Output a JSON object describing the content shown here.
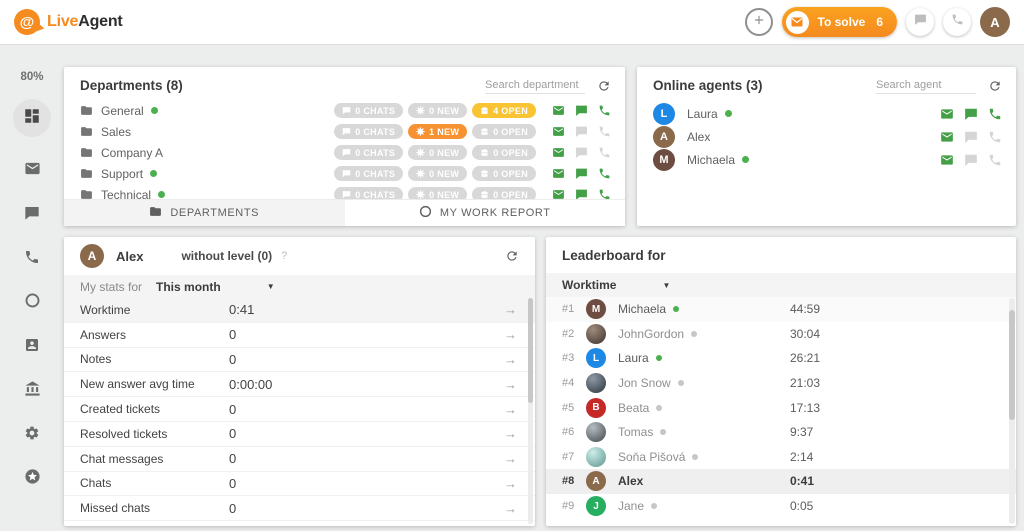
{
  "colors": {
    "brand_orange": "#f68b1f",
    "badge_yellow": "#f8c433",
    "badge_orange": "#f79233",
    "badge_gray": "#d8d8d8",
    "action_green": "#43a047",
    "online_green": "#4caf50",
    "away_gray": "#c6c6c6"
  },
  "header": {
    "logo_at": "@",
    "logo_live": "Live",
    "logo_agent": "Agent",
    "to_solve_label": "To solve",
    "to_solve_count": "6",
    "avatar_initial": "A"
  },
  "sidebar": {
    "usage_percent": "80%",
    "icons": [
      "dashboard",
      "mail",
      "chats",
      "calls",
      "worktime",
      "contacts",
      "company",
      "settings",
      "addons"
    ]
  },
  "departments_panel": {
    "title": "Departments (8)",
    "search_placeholder": "Search department",
    "refresh_icon": "refresh-icon",
    "rows": [
      {
        "name": "General",
        "online": true,
        "badges": [
          {
            "text": "0 CHATS",
            "style": "gray",
            "icon": "chat"
          },
          {
            "text": "0 NEW",
            "style": "gray",
            "icon": "new"
          },
          {
            "text": "4 OPEN",
            "style": "yellow",
            "icon": "open"
          }
        ],
        "mail": "on",
        "chat": "on",
        "phone": "on"
      },
      {
        "name": "Sales",
        "online": false,
        "badges": [
          {
            "text": "0 CHATS",
            "style": "gray",
            "icon": "chat"
          },
          {
            "text": "1 NEW",
            "style": "orange",
            "icon": "new"
          },
          {
            "text": "0 OPEN",
            "style": "gray",
            "icon": "open"
          }
        ],
        "mail": "on",
        "chat": "off",
        "phone": "off"
      },
      {
        "name": "Company A",
        "online": false,
        "badges": [
          {
            "text": "0 CHATS",
            "style": "gray",
            "icon": "chat"
          },
          {
            "text": "0 NEW",
            "style": "gray",
            "icon": "new"
          },
          {
            "text": "0 OPEN",
            "style": "gray",
            "icon": "open"
          }
        ],
        "mail": "on",
        "chat": "off",
        "phone": "off"
      },
      {
        "name": "Support",
        "online": true,
        "badges": [
          {
            "text": "0 CHATS",
            "style": "gray",
            "icon": "chat"
          },
          {
            "text": "0 NEW",
            "style": "gray",
            "icon": "new"
          },
          {
            "text": "0 OPEN",
            "style": "gray",
            "icon": "open"
          }
        ],
        "mail": "on",
        "chat": "on",
        "phone": "on"
      },
      {
        "name": "Technical",
        "online": true,
        "badges": [
          {
            "text": "0 CHATS",
            "style": "gray",
            "icon": "chat"
          },
          {
            "text": "0 NEW",
            "style": "gray",
            "icon": "new"
          },
          {
            "text": "0 OPEN",
            "style": "gray",
            "icon": "open"
          }
        ],
        "mail": "on",
        "chat": "on",
        "phone": "on"
      }
    ],
    "tabs": [
      {
        "label": "DEPARTMENTS",
        "icon": "folder-icon",
        "active": true
      },
      {
        "label": "MY WORK REPORT",
        "icon": "clock-icon",
        "active": false
      }
    ]
  },
  "agents_panel": {
    "title": "Online agents (3)",
    "search_placeholder": "Search agent",
    "rows": [
      {
        "initial": "L",
        "name": "Laura",
        "avatar_color": "#1e88e5",
        "online": true,
        "mail": "on",
        "chat": "on",
        "phone": "on"
      },
      {
        "initial": "A",
        "name": "Alex",
        "avatar_color": "#8a6a4b",
        "online": false,
        "mail": "on",
        "chat": "off",
        "phone": "off"
      },
      {
        "initial": "M",
        "name": "Michaela",
        "avatar_color": "#6d4c41",
        "online": true,
        "mail": "on",
        "chat": "off",
        "phone": "off"
      }
    ]
  },
  "report_panel": {
    "avatar_initial": "A",
    "avatar_color": "#8a6a4b",
    "agent_name": "Alex",
    "level_label": "without level (0)",
    "help": "?",
    "stats_for_label": "My stats for",
    "period": "This month",
    "stats": [
      {
        "label": "Worktime",
        "value": "0:41",
        "highlight": true
      },
      {
        "label": "Answers",
        "value": "0",
        "highlight": false
      },
      {
        "label": "Notes",
        "value": "0",
        "highlight": false
      },
      {
        "label": "New answer avg time",
        "value": "0:00:00",
        "highlight": false
      },
      {
        "label": "Created tickets",
        "value": "0",
        "highlight": false
      },
      {
        "label": "Resolved tickets",
        "value": "0",
        "highlight": false
      },
      {
        "label": "Chat messages",
        "value": "0",
        "highlight": false
      },
      {
        "label": "Chats",
        "value": "0",
        "highlight": false
      },
      {
        "label": "Missed chats",
        "value": "0",
        "highlight": false
      }
    ]
  },
  "leaderboard_panel": {
    "title": "Leaderboard for",
    "metric": "Worktime",
    "rows": [
      {
        "rank": "#1",
        "name": "Michaela",
        "value": "44:59",
        "avatar": {
          "type": "initial",
          "initial": "M",
          "color": "#6d4c41"
        },
        "presence": "online",
        "highlight": "light"
      },
      {
        "rank": "#2",
        "name": "JohnGordon",
        "value": "30:04",
        "avatar": {
          "type": "photo",
          "c1": "#a08c7d",
          "c2": "#3a302a"
        },
        "presence": "away",
        "highlight": "none"
      },
      {
        "rank": "#3",
        "name": "Laura",
        "value": "26:21",
        "avatar": {
          "type": "initial",
          "initial": "L",
          "color": "#1e88e5"
        },
        "presence": "online",
        "highlight": "none"
      },
      {
        "rank": "#4",
        "name": "Jon Snow",
        "value": "21:03",
        "avatar": {
          "type": "photo",
          "c1": "#8d9aa5",
          "c2": "#2b333a"
        },
        "presence": "away",
        "highlight": "none"
      },
      {
        "rank": "#5",
        "name": "Beata",
        "value": "17:13",
        "avatar": {
          "type": "initial",
          "initial": "B",
          "color": "#c62828"
        },
        "presence": "away",
        "highlight": "none"
      },
      {
        "rank": "#6",
        "name": "Tomas",
        "value": "9:37",
        "avatar": {
          "type": "photo",
          "c1": "#b6bec2",
          "c2": "#3f474c"
        },
        "presence": "away",
        "highlight": "none"
      },
      {
        "rank": "#7",
        "name": "Soňa Pišová",
        "value": "2:14",
        "avatar": {
          "type": "photo",
          "c1": "#cdeee9",
          "c2": "#5d948d"
        },
        "presence": "away",
        "highlight": "none"
      },
      {
        "rank": "#8",
        "name": "Alex",
        "value": "0:41",
        "avatar": {
          "type": "initial",
          "initial": "A",
          "color": "#8a6a4b"
        },
        "presence": "none",
        "highlight": "strong"
      },
      {
        "rank": "#9",
        "name": "Jane",
        "value": "0:05",
        "avatar": {
          "type": "initial",
          "initial": "J",
          "color": "#27ae60"
        },
        "presence": "away",
        "highlight": "none"
      }
    ]
  }
}
